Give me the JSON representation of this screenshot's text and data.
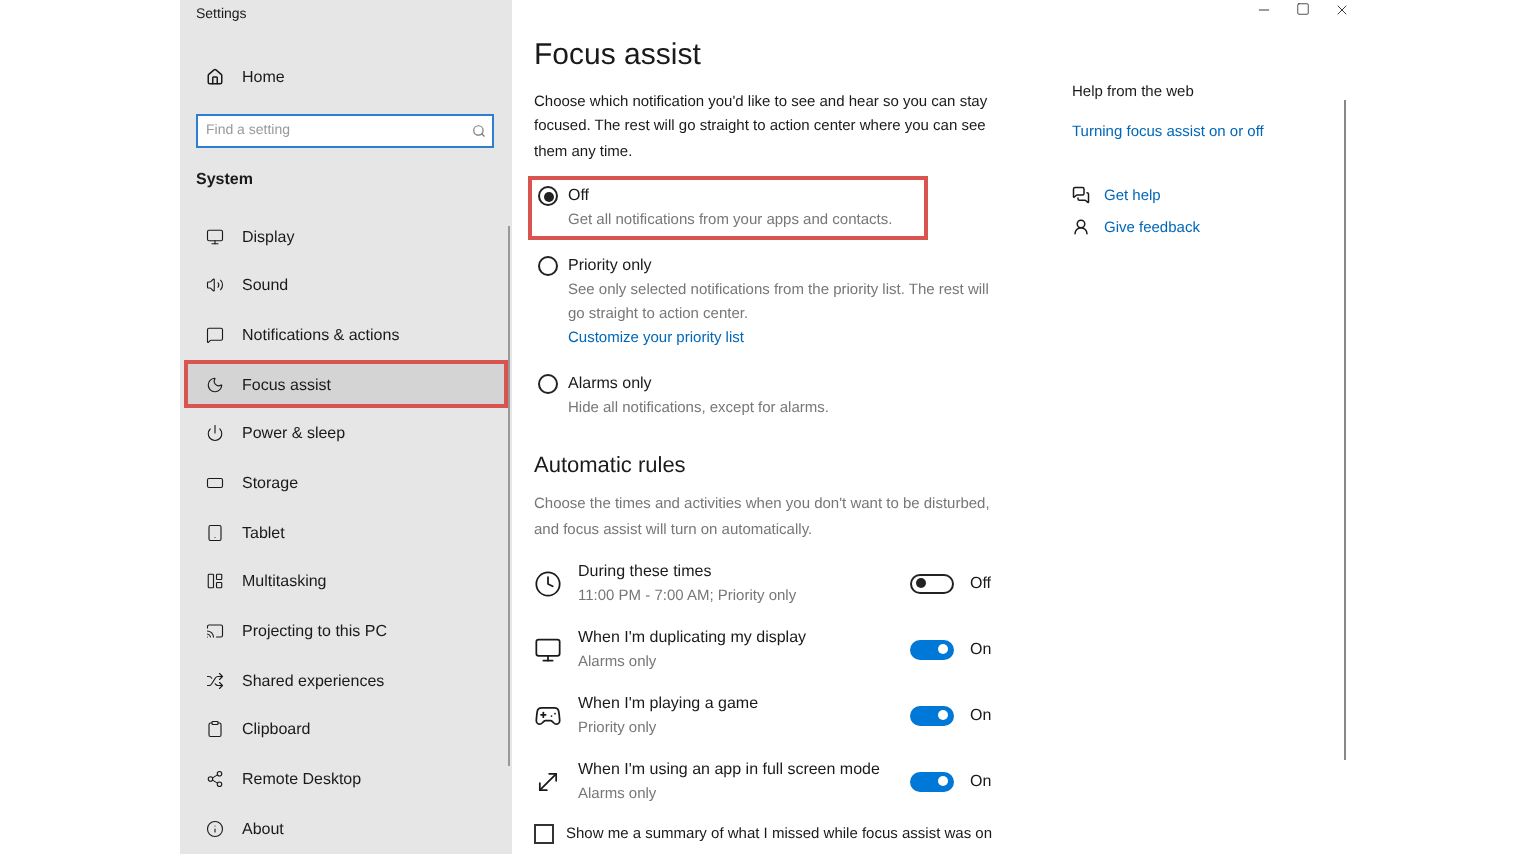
{
  "window": {
    "title": "Settings"
  },
  "sidebar": {
    "home": "Home",
    "search": {
      "placeholder": "Find a setting"
    },
    "section": "System",
    "items": [
      {
        "label": "Display",
        "selected": false,
        "highlighted": false
      },
      {
        "label": "Sound",
        "selected": false,
        "highlighted": false
      },
      {
        "label": "Notifications & actions",
        "selected": false,
        "highlighted": false
      },
      {
        "label": "Focus assist",
        "selected": true,
        "highlighted": true
      },
      {
        "label": "Power & sleep",
        "selected": false,
        "highlighted": false
      },
      {
        "label": "Storage",
        "selected": false,
        "highlighted": false
      },
      {
        "label": "Tablet",
        "selected": false,
        "highlighted": false
      },
      {
        "label": "Multitasking",
        "selected": false,
        "highlighted": false
      },
      {
        "label": "Projecting to this PC",
        "selected": false,
        "highlighted": false
      },
      {
        "label": "Shared experiences",
        "selected": false,
        "highlighted": false
      },
      {
        "label": "Clipboard",
        "selected": false,
        "highlighted": false
      },
      {
        "label": "Remote Desktop",
        "selected": false,
        "highlighted": false
      },
      {
        "label": "About",
        "selected": false,
        "highlighted": false
      }
    ]
  },
  "main": {
    "title": "Focus assist",
    "intro": "Choose which notification you'd like to see and hear so you can stay focused. The rest will go straight to action center where you can see them any time.",
    "options": [
      {
        "label": "Off",
        "description": "Get all notifications from your apps and contacts.",
        "selected": true,
        "highlighted": true
      },
      {
        "label": "Priority only",
        "description": "See only selected notifications from the priority list. The rest will go straight to action center.",
        "link": "Customize your priority list",
        "selected": false,
        "highlighted": false
      },
      {
        "label": "Alarms only",
        "description": "Hide all notifications, except for alarms.",
        "selected": false,
        "highlighted": false
      }
    ],
    "rules_heading": "Automatic rules",
    "rules_intro": "Choose the times and activities when you don't want to be disturbed, and focus assist will turn on automatically.",
    "rules": [
      {
        "title": "During these times",
        "subtitle": "11:00 PM - 7:00 AM; Priority only",
        "on": false,
        "state_label": "Off"
      },
      {
        "title": "When I'm duplicating my display",
        "subtitle": "Alarms only",
        "on": true,
        "state_label": "On"
      },
      {
        "title": "When I'm playing a game",
        "subtitle": "Priority only",
        "on": true,
        "state_label": "On"
      },
      {
        "title": "When I'm using an app in full screen mode",
        "subtitle": "Alarms only",
        "on": true,
        "state_label": "On"
      }
    ],
    "summary": {
      "label": "Show me a summary of what I missed while focus assist was on",
      "checked": false
    }
  },
  "help": {
    "heading": "Help from the web",
    "link": "Turning focus assist on or off",
    "actions": [
      "Get help",
      "Give feedback"
    ]
  }
}
